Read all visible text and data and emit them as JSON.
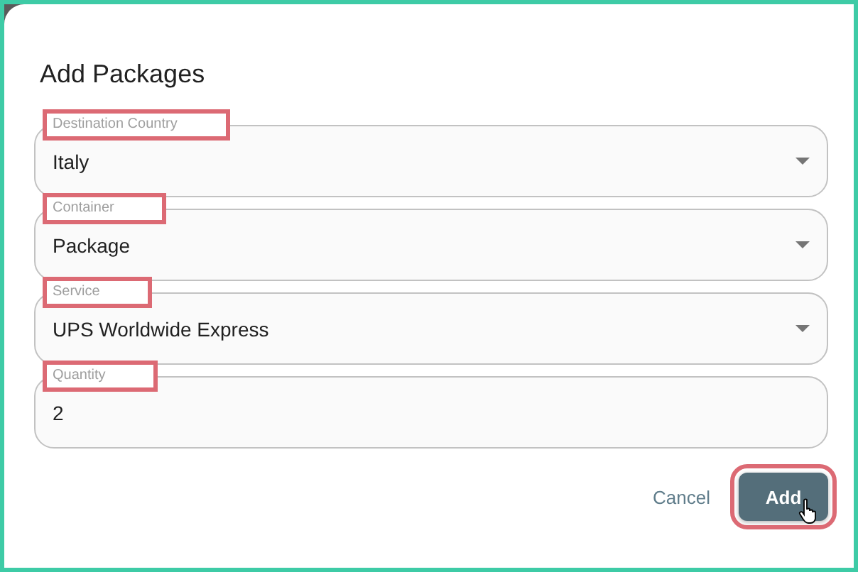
{
  "dialog": {
    "title": "Add Packages",
    "fields": [
      {
        "kind": "select",
        "label": "Destination Country",
        "value": "Italy",
        "highlighted": true
      },
      {
        "kind": "select",
        "label": "Container",
        "value": "Package",
        "highlighted": true
      },
      {
        "kind": "select",
        "label": "Service",
        "value": "UPS Worldwide Express",
        "highlighted": true
      },
      {
        "kind": "input",
        "label": "Quantity",
        "value": "2",
        "highlighted": true
      }
    ],
    "buttons": [
      {
        "kind": "text",
        "label": "Cancel",
        "highlighted": false
      },
      {
        "kind": "primary",
        "label": "Add",
        "highlighted": true,
        "cursor": true
      }
    ]
  }
}
